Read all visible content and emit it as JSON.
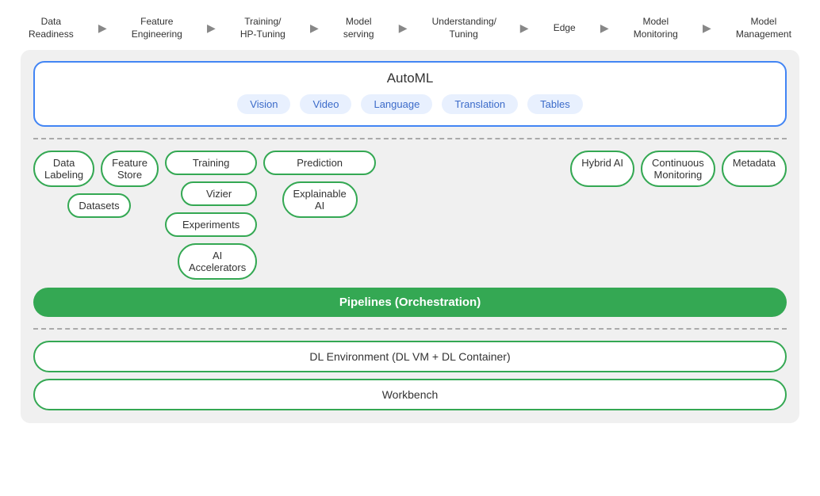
{
  "pipeline_steps": [
    {
      "label": "Data\nReadiness"
    },
    {
      "label": "Feature\nEngineering"
    },
    {
      "label": "Training/\nHP-Tuning"
    },
    {
      "label": "Model\nserving"
    },
    {
      "label": "Understanding/\nTuning"
    },
    {
      "label": "Edge"
    },
    {
      "label": "Model\nMonitoring"
    },
    {
      "label": "Model\nManagement"
    }
  ],
  "automl": {
    "title": "AutoML",
    "chips": [
      "Vision",
      "Video",
      "Language",
      "Translation",
      "Tables"
    ]
  },
  "services_row1": {
    "left": [
      "Data\nLabeling",
      "Feature\nStore"
    ],
    "training": [
      "Training",
      "Vizier",
      "Experiments",
      "AI\nAccelerators"
    ],
    "prediction": [
      "Prediction",
      "Explainable\nAI"
    ],
    "right": [
      "Hybrid AI",
      "Continuous\nMonitoring",
      "Metadata"
    ]
  },
  "pipelines_bar": "Pipelines (Orchestration)",
  "bottom": {
    "dl_env": "DL Environment (DL VM + DL Container)",
    "workbench": "Workbench"
  }
}
